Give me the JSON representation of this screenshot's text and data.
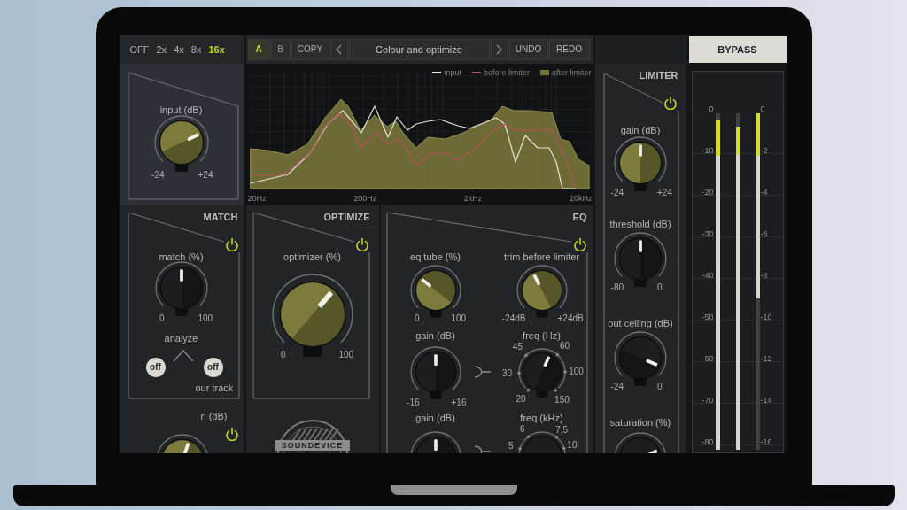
{
  "oversampling": [
    {
      "label": "OFF",
      "selected": false
    },
    {
      "label": "2x",
      "selected": false
    },
    {
      "label": "4x",
      "selected": false
    },
    {
      "label": "8x",
      "selected": false
    },
    {
      "label": "16x",
      "selected": true
    }
  ],
  "toolbar": {
    "slots": [
      {
        "label": "A",
        "selected": true
      },
      {
        "label": "B",
        "selected": false
      }
    ],
    "copy": "COPY",
    "preset": "Colour and optimize",
    "undo": "UNDO",
    "redo": "REDO"
  },
  "bypass": {
    "label": "BYPASS"
  },
  "spectrum": {
    "legend": [
      {
        "label": "input",
        "kind": "line",
        "color": "#e2e2d6"
      },
      {
        "label": "before limiter",
        "kind": "line",
        "color": "#b9525c"
      },
      {
        "label": "after limiter",
        "kind": "area",
        "color": "#74733a"
      }
    ],
    "x_labels": [
      "20Hz",
      "200Hz",
      "2kHz",
      "20kHz"
    ]
  },
  "input": {
    "knob": {
      "label": "input (dB)",
      "min": "-24",
      "max": "+24",
      "level": 0.74,
      "color": "#7c7b3b"
    }
  },
  "match": {
    "title": "MATCH",
    "power": {
      "on": true
    },
    "knob": {
      "label": "match (%)",
      "min": "0",
      "max": "100",
      "level": 0.5,
      "color": "#1b1d1f"
    },
    "analyze": {
      "label": "analyze",
      "toggles": [
        {
          "label": "off"
        },
        {
          "label": "off"
        }
      ],
      "caption": "our track"
    },
    "gain": {
      "label": "n (dB)",
      "power": {
        "on": true
      },
      "knob": {
        "level": 0.57,
        "color": "#7c7b3b"
      }
    }
  },
  "optimize": {
    "title": "OPTIMIZE",
    "power": {
      "on": true
    },
    "knob": {
      "label": "optimizer (%)",
      "min": "0",
      "max": "100",
      "level": 0.65,
      "color": "#7c7b3b"
    },
    "logo": "SOUNDEVICE"
  },
  "eq": {
    "title": "EQ",
    "power": {
      "on": true
    },
    "rows": [
      {
        "linked": false,
        "left": {
          "label": "eq tube (%)",
          "min": "0",
          "max": "100",
          "level": 0.31,
          "color": "#7c7b3b"
        },
        "right": {
          "label": "trim before limiter",
          "min": "-24dB",
          "max": "+24dB",
          "level": 0.4,
          "color": "#7c7b3b"
        }
      },
      {
        "linked": true,
        "left": {
          "label": "gain (dB)",
          "min": "-16",
          "max": "+16",
          "level": 0.5,
          "color": "#1b1d1f"
        },
        "right": {
          "label": "freq (Hz)",
          "scale": [
            "20",
            "30",
            "45",
            "60",
            "100",
            "150"
          ],
          "level": 0.59,
          "color": "#1b1d1f"
        }
      },
      {
        "linked": true,
        "left": {
          "label": "gain (dB)",
          "level": 0.5,
          "color": "#1b1d1f"
        },
        "right": {
          "label": "freq (kHz)",
          "scale": [
            "5",
            "6",
            "7,5",
            "10"
          ],
          "color": "#1b1d1f"
        }
      }
    ]
  },
  "limiter": {
    "title": "LIMITER",
    "power": {
      "on": true
    },
    "knobs": [
      {
        "label": "gain (dB)",
        "min": "-24",
        "max": "+24",
        "level": 0.5,
        "color": "#7c7b3b"
      },
      {
        "label": "threshold (dB)",
        "min": "-80",
        "max": "0",
        "level": 0.5,
        "color": "#1b1d1f"
      },
      {
        "label": "out ceiling (dB)",
        "min": "-24",
        "max": "0",
        "level": 0.92,
        "color": "#1b1d1f"
      },
      {
        "label": "saturation (%)",
        "level": 0.74,
        "color": "#1b1d1f"
      }
    ]
  },
  "meters": {
    "left_scale": [
      "0",
      "-10",
      "-20",
      "-30",
      "-40",
      "-50",
      "-60",
      "-70",
      "-80"
    ],
    "right_scale": [
      "0",
      "-2",
      "-4",
      "-6",
      "-8",
      "-10",
      "-12",
      "-14",
      "-16"
    ],
    "bars": [
      {
        "kind": "level",
        "level": 0.98
      },
      {
        "kind": "level",
        "level": 0.96
      },
      {
        "kind": "reduction",
        "level": 0.55
      }
    ]
  }
}
